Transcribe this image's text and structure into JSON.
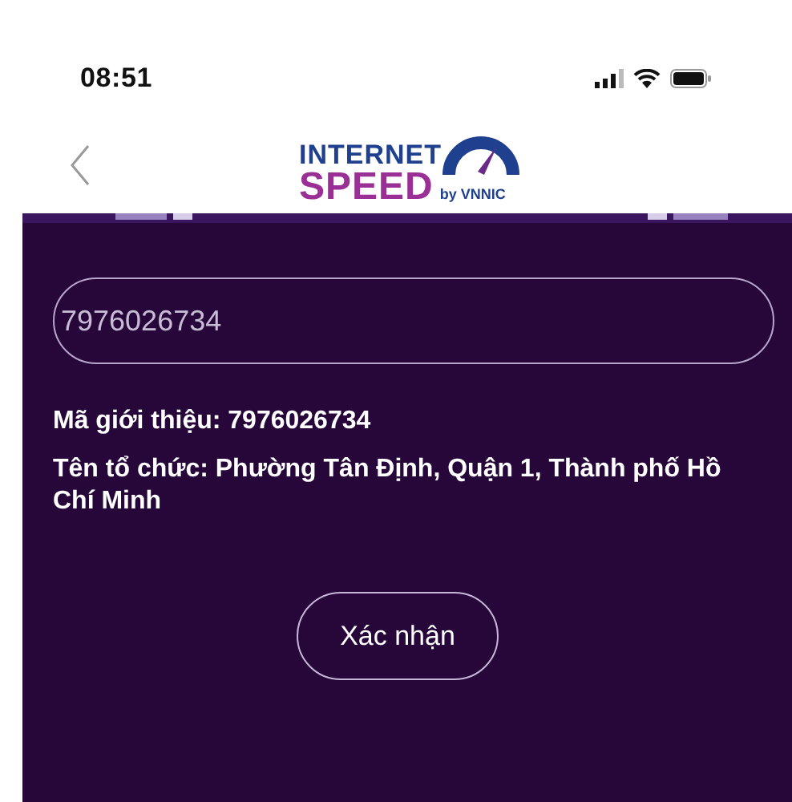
{
  "status_bar": {
    "time": "08:51"
  },
  "header": {
    "logo": {
      "line_1": "INTERNET",
      "line_2": "SPEED",
      "byline": "by VNNIC"
    }
  },
  "form": {
    "code_field": {
      "value": "7976026734"
    },
    "info": [
      "Mã giới thiệu: 7976026734",
      "Tên tổ chức: Phường Tân Định, Quận 1, Thành phố Hồ Chí Minh"
    ],
    "button": "Xác nhận"
  }
}
